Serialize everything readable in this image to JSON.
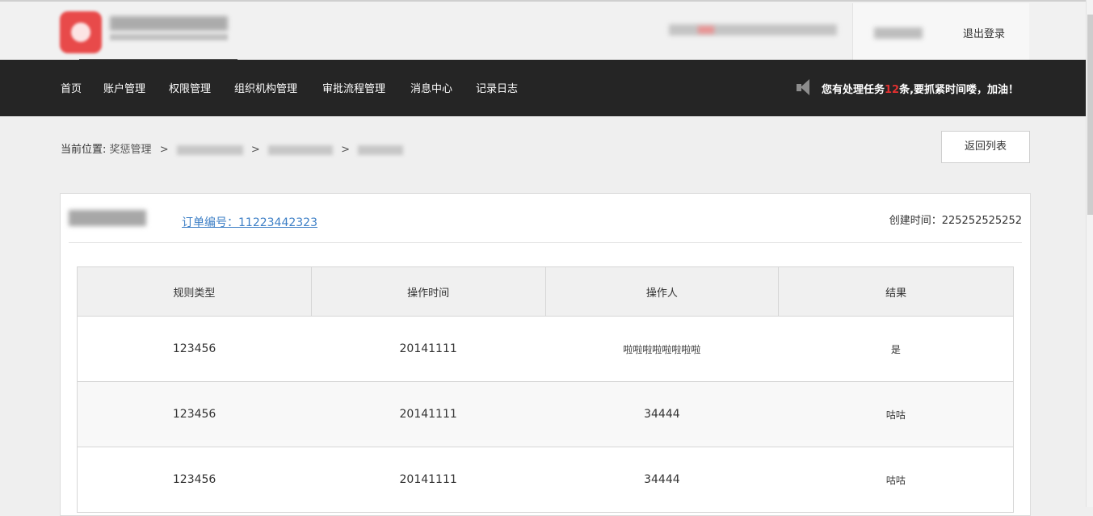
{
  "header": {
    "logout_label": "退出登录"
  },
  "nav": {
    "items": [
      "首页",
      "账户管理",
      "权限管理",
      "组织机构管理",
      "审批流程管理",
      "消息中心",
      "记录日志"
    ],
    "task_prefix": "您有处理任务",
    "task_count": "12",
    "task_suffix": "条,要抓紧时间喽，加油！"
  },
  "breadcrumb": {
    "label": "当前位置:",
    "first": "奖惩管理",
    "separator": ">"
  },
  "back_button": "返回列表",
  "panel": {
    "order_label": "订单编号：11223442323",
    "created_label": "创建时间：225252525252"
  },
  "table": {
    "headers": [
      "规则类型",
      "操作时间",
      "操作人",
      "结果"
    ],
    "rows": [
      [
        "123456",
        "20141111",
        "啦啦啦啦啦啦啦啦",
        "是"
      ],
      [
        "123456",
        "20141111",
        "34444",
        "咕咕"
      ],
      [
        "123456",
        "20141111",
        "34444",
        "咕咕"
      ]
    ]
  },
  "colors": {
    "nav_bg": "#252525",
    "accent_link": "#3d7fc6",
    "task_count": "#e03030"
  },
  "icons": {
    "notice": "speaker-icon"
  }
}
